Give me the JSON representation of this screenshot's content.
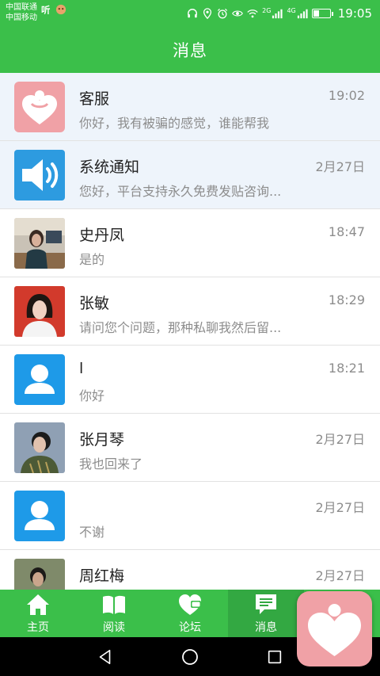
{
  "status_bar": {
    "carrier_1": "中国联通",
    "carrier_2": "中国移动",
    "network_1": "2G",
    "network_2": "4G",
    "time": "19:05",
    "battery_level": 0.35
  },
  "header": {
    "title": "消息"
  },
  "colors": {
    "brand_green": "#3bbf4a",
    "active_tab": "#33a842",
    "pinned_row": "#eef4fb",
    "muted_text": "#8d8d8d",
    "service_pink": "#f0a1a6",
    "system_blue": "#2d9be0",
    "default_avatar_blue": "#1e9ae8"
  },
  "messages": [
    {
      "name": "客服",
      "time": "19:02",
      "preview": "你好，我有被骗的感觉，谁能帮我",
      "avatar": "heart-icon",
      "pinned": true
    },
    {
      "name": "系统通知",
      "time": "2月27日",
      "preview": "您好，平台支持永久免费发贴咨询...",
      "avatar": "speaker-icon",
      "pinned": true
    },
    {
      "name": "史丹凤",
      "time": "18:47",
      "preview": "是的",
      "avatar": "photo",
      "pinned": false
    },
    {
      "name": "张敏",
      "time": "18:29",
      "preview": "请问您个问题，那种私聊我然后留...",
      "avatar": "photo",
      "pinned": false
    },
    {
      "name": "l",
      "time": "18:21",
      "preview": "你好",
      "avatar": "default-user-icon",
      "pinned": false
    },
    {
      "name": "张月琴",
      "time": "2月27日",
      "preview": "我也回来了",
      "avatar": "photo",
      "pinned": false
    },
    {
      "name": "",
      "time": "2月27日",
      "preview": "不谢",
      "avatar": "default-user-icon",
      "pinned": false
    },
    {
      "name": "周红梅",
      "time": "2月27日",
      "preview": "",
      "avatar": "photo",
      "pinned": false
    }
  ],
  "tabs": [
    {
      "label": "主页",
      "icon": "home-icon",
      "active": false
    },
    {
      "label": "阅读",
      "icon": "book-icon",
      "active": false
    },
    {
      "label": "论坛",
      "icon": "heart-chat-icon",
      "active": false
    },
    {
      "label": "消息",
      "icon": "message-icon",
      "active": true
    }
  ],
  "nav": {
    "back": "back-icon",
    "home": "home-circle-icon",
    "recents": "recents-icon"
  }
}
